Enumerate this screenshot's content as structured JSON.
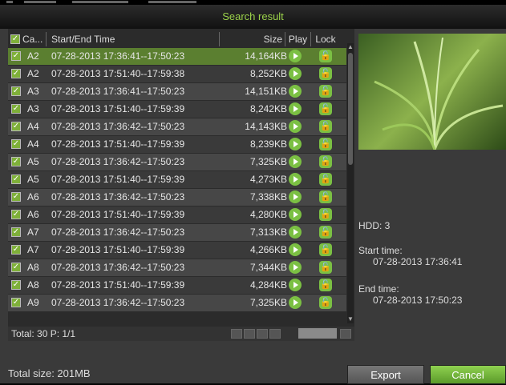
{
  "window": {
    "title": "Search result"
  },
  "table": {
    "headers": {
      "camera": "Ca...",
      "time": "Start/End Time",
      "size": "Size",
      "play": "Play",
      "lock": "Lock"
    },
    "rows": [
      {
        "camera": "A2",
        "time": "07-28-2013 17:36:41--17:50:23",
        "size": "14,164KB"
      },
      {
        "camera": "A2",
        "time": "07-28-2013 17:51:40--17:59:38",
        "size": "8,252KB"
      },
      {
        "camera": "A3",
        "time": "07-28-2013 17:36:41--17:50:23",
        "size": "14,151KB"
      },
      {
        "camera": "A3",
        "time": "07-28-2013 17:51:40--17:59:39",
        "size": "8,242KB"
      },
      {
        "camera": "A4",
        "time": "07-28-2013 17:36:42--17:50:23",
        "size": "14,143KB"
      },
      {
        "camera": "A4",
        "time": "07-28-2013 17:51:40--17:59:39",
        "size": "8,239KB"
      },
      {
        "camera": "A5",
        "time": "07-28-2013 17:36:42--17:50:23",
        "size": "7,325KB"
      },
      {
        "camera": "A5",
        "time": "07-28-2013 17:51:40--17:59:39",
        "size": "4,273KB"
      },
      {
        "camera": "A6",
        "time": "07-28-2013 17:36:42--17:50:23",
        "size": "7,338KB"
      },
      {
        "camera": "A6",
        "time": "07-28-2013 17:51:40--17:59:39",
        "size": "4,280KB"
      },
      {
        "camera": "A7",
        "time": "07-28-2013 17:36:42--17:50:23",
        "size": "7,313KB"
      },
      {
        "camera": "A7",
        "time": "07-28-2013 17:51:40--17:59:39",
        "size": "4,266KB"
      },
      {
        "camera": "A8",
        "time": "07-28-2013 17:36:42--17:50:23",
        "size": "7,344KB"
      },
      {
        "camera": "A8",
        "time": "07-28-2013 17:51:40--17:59:39",
        "size": "4,284KB"
      },
      {
        "camera": "A9",
        "time": "07-28-2013 17:36:42--17:50:23",
        "size": "7,325KB"
      }
    ],
    "footer": "Total: 30  P: 1/1"
  },
  "details": {
    "hdd": "HDD: 3",
    "start_label": "Start time:",
    "start_value": "07-28-2013 17:36:41",
    "end_label": "End time:",
    "end_value": "07-28-2013 17:50:23"
  },
  "bottom": {
    "total_size": "Total size: 201MB",
    "export_label": "Export",
    "cancel_label": "Cancel"
  },
  "colors": {
    "accent": "#7bc043",
    "title_text": "#9bd24a"
  }
}
